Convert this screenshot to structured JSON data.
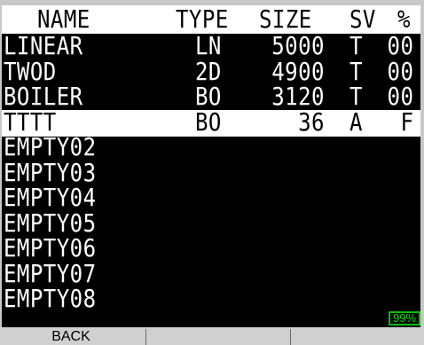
{
  "header": {
    "name": "NAME",
    "type": "TYPE",
    "size": "SIZE",
    "sv": "SV",
    "pct": "%"
  },
  "files": [
    {
      "name": "LINEAR",
      "type": "LN",
      "size": "5000",
      "sv": "T",
      "pct": "00",
      "selected": false
    },
    {
      "name": "TWOD",
      "type": "2D",
      "size": "4900",
      "sv": "T",
      "pct": "00",
      "selected": false
    },
    {
      "name": "BOILER",
      "type": "BO",
      "size": "3120",
      "sv": "T",
      "pct": "00",
      "selected": false
    },
    {
      "name": "TTTT",
      "type": "BO",
      "size": "36",
      "sv": "A",
      "pct": "F",
      "selected": true
    },
    {
      "name": "EMPTY02"
    },
    {
      "name": "EMPTY03"
    },
    {
      "name": "EMPTY04"
    },
    {
      "name": "EMPTY05"
    },
    {
      "name": "EMPTY06"
    },
    {
      "name": "EMPTY07"
    },
    {
      "name": "EMPTY08"
    }
  ],
  "battery": "99%",
  "softkeys": [
    "BACK",
    "",
    "",
    ""
  ]
}
